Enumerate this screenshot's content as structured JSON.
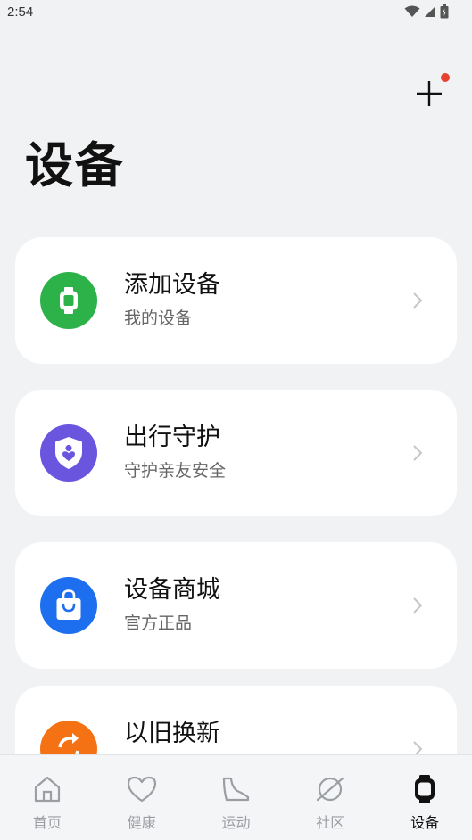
{
  "status_bar": {
    "time": "2:54",
    "icons": [
      "wifi-icon",
      "signal-icon",
      "battery-icon"
    ]
  },
  "header": {
    "title": "设备",
    "add_icon": "plus-icon",
    "badge_color": "#e8412f"
  },
  "cards": [
    {
      "title": "添加设备",
      "subtitle": "我的设备",
      "icon": "watch-icon",
      "color": "#2db24a"
    },
    {
      "title": "出行守护",
      "subtitle": "守护亲友安全",
      "icon": "shield-heart-icon",
      "color": "#6a55df"
    },
    {
      "title": "设备商城",
      "subtitle": "官方正品",
      "icon": "shopping-bag-icon",
      "color": "#1e6ef0"
    },
    {
      "title": "以旧换新",
      "subtitle": "",
      "icon": "trade-in-icon",
      "color": "#f57214"
    }
  ],
  "bottom_nav": {
    "items": [
      {
        "label": "首页",
        "icon": "home-icon",
        "active": false
      },
      {
        "label": "健康",
        "icon": "heart-icon",
        "active": false
      },
      {
        "label": "运动",
        "icon": "shoe-icon",
        "active": false
      },
      {
        "label": "社区",
        "icon": "planet-icon",
        "active": false
      },
      {
        "label": "设备",
        "icon": "watch-icon",
        "active": true
      }
    ]
  }
}
